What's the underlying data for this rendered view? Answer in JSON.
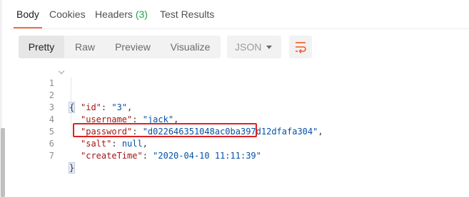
{
  "tabs": {
    "body": "Body",
    "cookies": "Cookies",
    "headers_label": "Headers",
    "headers_count": "(3)",
    "test_results": "Test Results"
  },
  "view_modes": {
    "pretty": "Pretty",
    "raw": "Raw",
    "preview": "Preview",
    "visualize": "Visualize",
    "active": "Pretty"
  },
  "format_select": {
    "value": "JSON"
  },
  "wrap_button": {
    "icon": "wrap-lines-icon"
  },
  "code": {
    "line_numbers": [
      "1",
      "2",
      "3",
      "4",
      "5",
      "6",
      "7"
    ],
    "open_brace": "{",
    "close_brace": "}",
    "fields": [
      {
        "key": "\"id\"",
        "sep": ": ",
        "value": "\"3\"",
        "tail": ","
      },
      {
        "key": "\"username\"",
        "sep": ": ",
        "value": "\"jack\"",
        "tail": ","
      },
      {
        "key": "\"password\"",
        "sep": ": ",
        "value": "\"d022646351048ac0ba397d12dfafa304\"",
        "tail": ","
      },
      {
        "key": "\"salt\"",
        "sep": ": ",
        "value": "null",
        "tail": ","
      },
      {
        "key": "\"createTime\"",
        "sep": ": ",
        "value": "\"2020-04-10 11:11:39\"",
        "tail": ""
      }
    ]
  },
  "colors": {
    "accent_tab": "#f26b3a",
    "count_green": "#21a049",
    "annotation_red": "#e02020",
    "json_key": "#a31515",
    "json_value": "#0451a5"
  }
}
